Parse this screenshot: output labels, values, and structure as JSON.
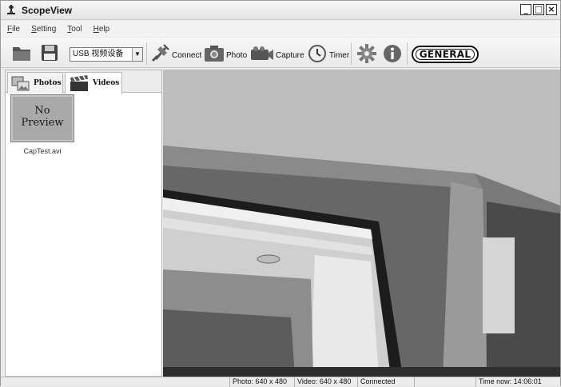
{
  "window": {
    "title": "ScopeView",
    "controls": [
      "_",
      "□",
      "×"
    ]
  },
  "menu": [
    {
      "accel": "F",
      "rest": "ile"
    },
    {
      "accel": "S",
      "rest": "etting"
    },
    {
      "accel": "T",
      "rest": "ool"
    },
    {
      "accel": "H",
      "rest": "elp"
    }
  ],
  "toolbar": {
    "open_icon": "folder-icon",
    "save_icon": "floppy-icon",
    "device": "USB 视频设备",
    "connect_label": "Connect",
    "photo_label": "Photo",
    "capture_label": "Capture",
    "timer_label": "Timer",
    "settings_icon": "gear-icon",
    "info_icon": "info-icon",
    "brand_logo": "GENERAL"
  },
  "left_panel": {
    "tabs": [
      {
        "label": "Photos",
        "icon": "photos-icon"
      },
      {
        "label": "Videos",
        "icon": "clapperboard-icon"
      }
    ],
    "active_tab": "Videos",
    "items": [
      {
        "preview_line1": "No",
        "preview_line2": "Preview",
        "filename": "CapTest.avi"
      }
    ]
  },
  "status": {
    "photo_res": "Photo: 640 x 480",
    "video_res": "Video: 640 x 480",
    "connection": "Connected",
    "time": "Time now: 14:06:01"
  }
}
